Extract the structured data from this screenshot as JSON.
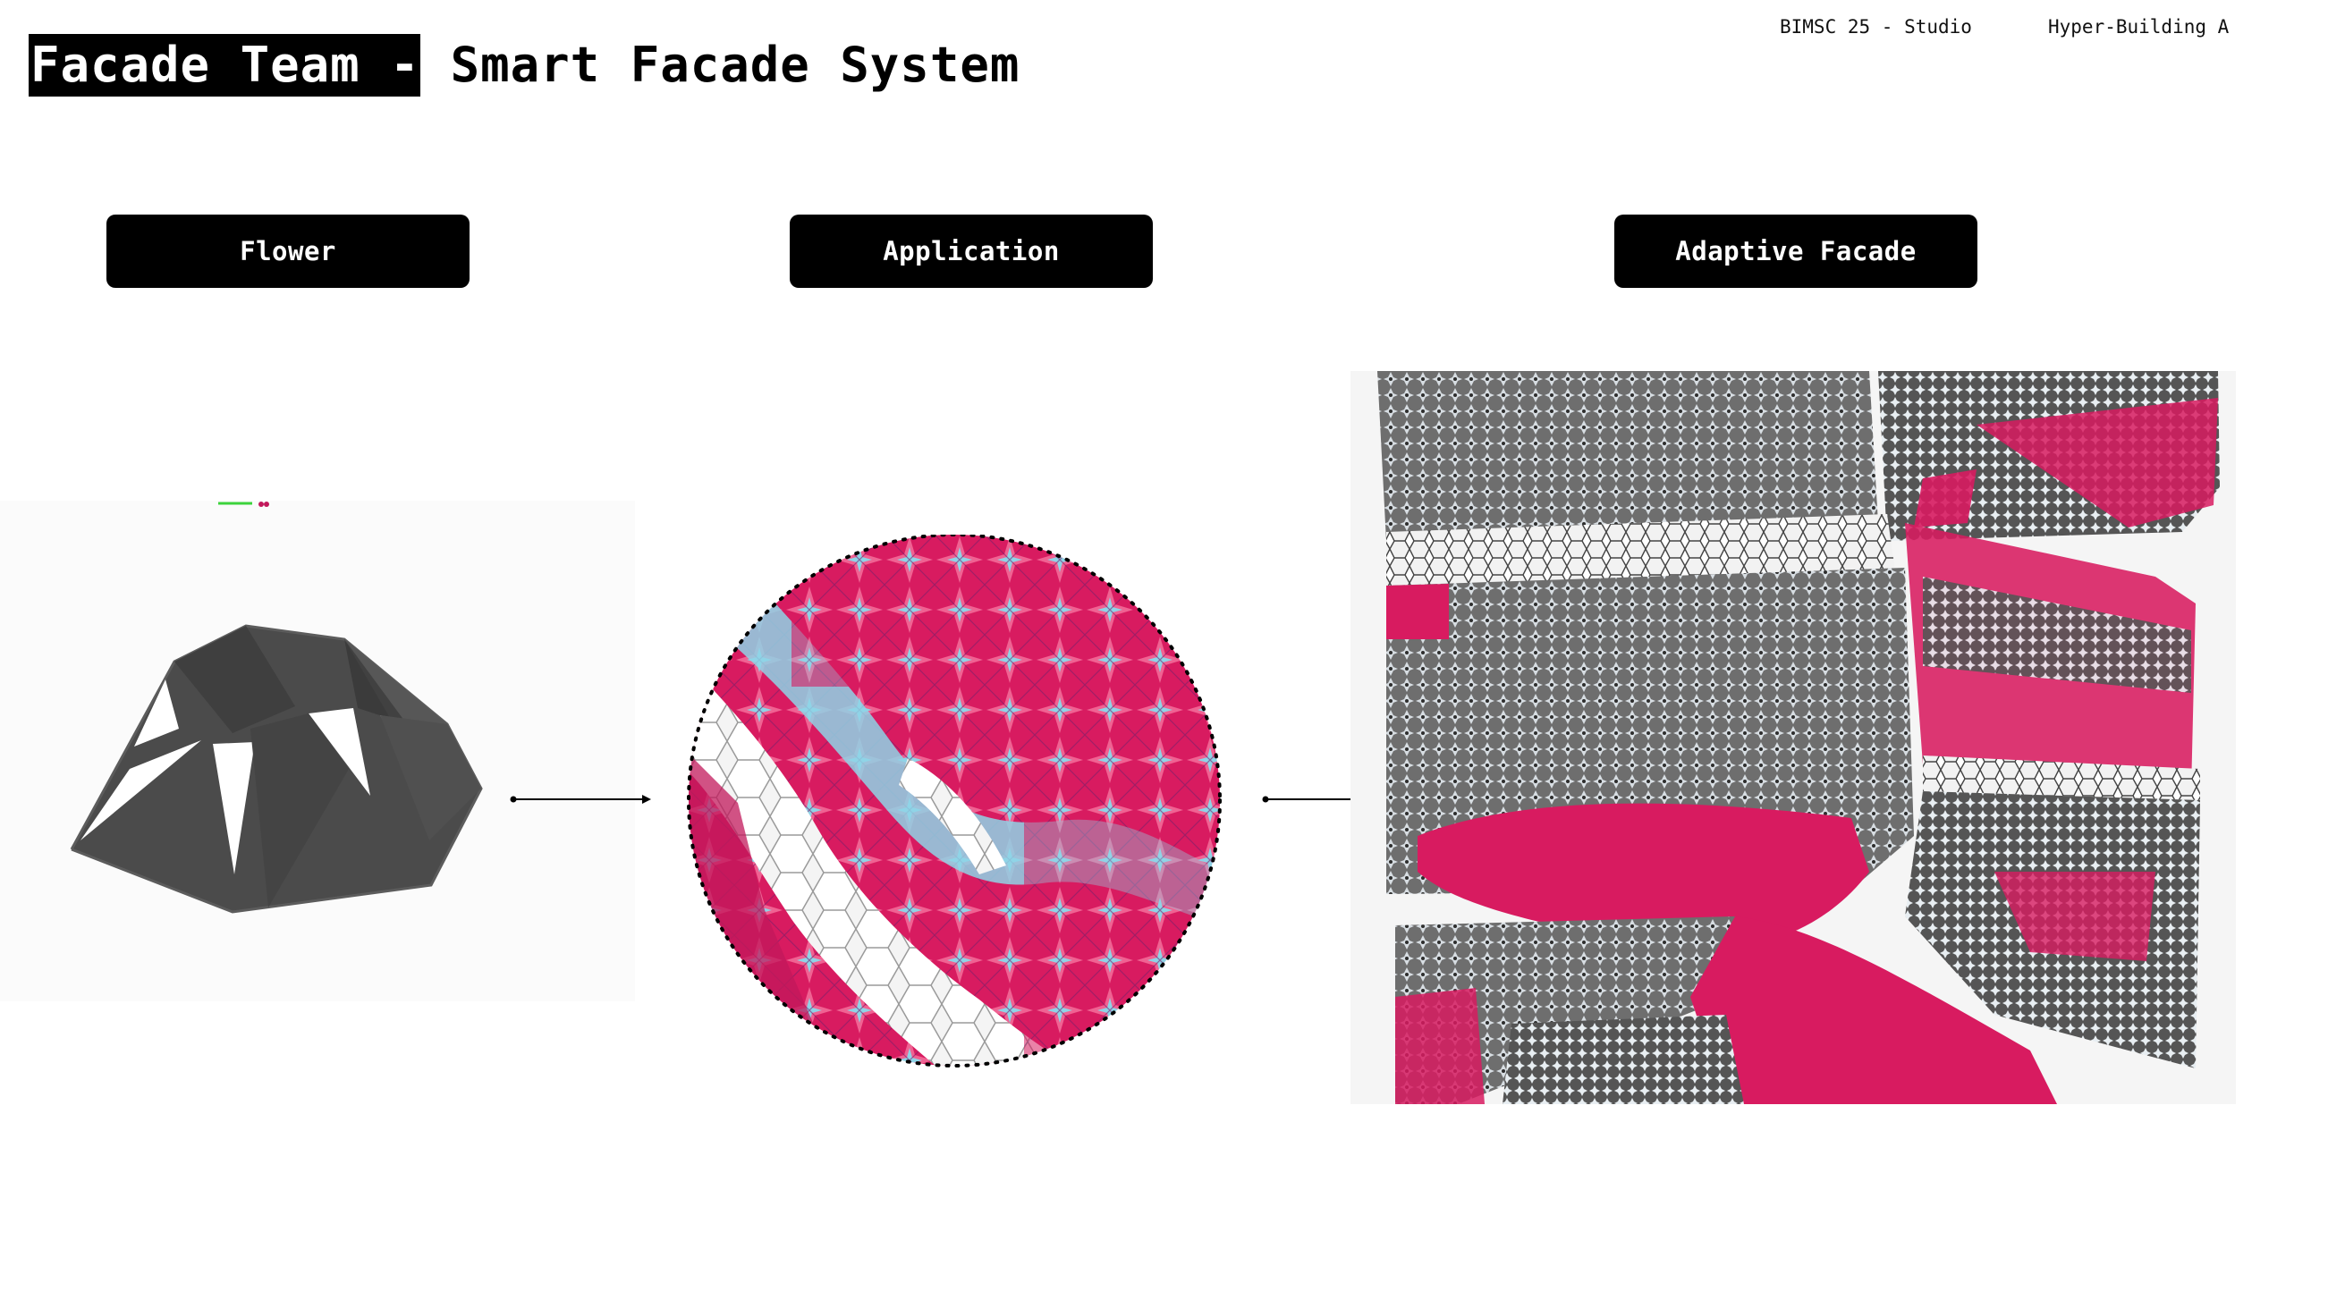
{
  "header": {
    "title_highlight": "Facade Team -",
    "title_rest": "Smart Facade System",
    "meta_left": "BIMSC 25 - Studio",
    "meta_right": "Hyper-Building A"
  },
  "stages": [
    {
      "label": "Flower"
    },
    {
      "label": "Application"
    },
    {
      "label": "Adaptive Facade"
    }
  ],
  "colors": {
    "accent_magenta": "#d81b60",
    "light_blue": "#8fd3e6",
    "dark_gray": "#4a4a4a"
  }
}
